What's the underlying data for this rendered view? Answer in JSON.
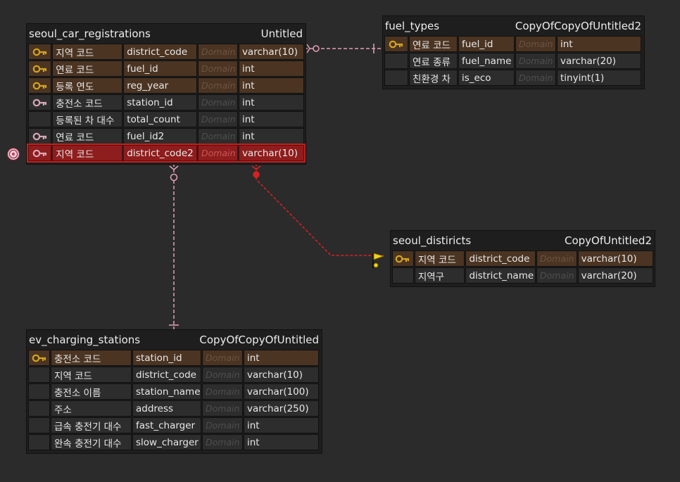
{
  "tables": {
    "seoul_car_registrations": {
      "name": "seoul_car_registrations",
      "model": "Untitled",
      "rows": [
        {
          "label": "지역 코드",
          "column": "district_code",
          "domain": "Domain",
          "type": "varchar(10)",
          "key": "pk"
        },
        {
          "label": "연료 코드",
          "column": "fuel_id",
          "domain": "Domain",
          "type": "int",
          "key": "pk"
        },
        {
          "label": "등록 연도",
          "column": "reg_year",
          "domain": "Domain",
          "type": "int",
          "key": "pk"
        },
        {
          "label": "충전소 코드",
          "column": "station_id",
          "domain": "Domain",
          "type": "int",
          "key": "fk"
        },
        {
          "label": "등록된 차 대수",
          "column": "total_count",
          "domain": "Domain",
          "type": "int",
          "key": "none"
        },
        {
          "label": "연료 코드",
          "column": "fuel_id2",
          "domain": "Domain",
          "type": "int",
          "key": "fk"
        },
        {
          "label": "지역 코드",
          "column": "district_code2",
          "domain": "Domain",
          "type": "varchar(10)",
          "key": "fk"
        }
      ]
    },
    "fuel_types": {
      "name": "fuel_types",
      "model": "CopyOfCopyOfUntitled2",
      "rows": [
        {
          "label": "연료 코드",
          "column": "fuel_id",
          "domain": "Domain",
          "type": "int",
          "key": "pk"
        },
        {
          "label": "연료 종류",
          "column": "fuel_name",
          "domain": "Domain",
          "type": "varchar(20)",
          "key": "none"
        },
        {
          "label": "친환경 차",
          "column": "is_eco",
          "domain": "Domain",
          "type": "tinyint(1)",
          "key": "none"
        }
      ]
    },
    "seoul_distiricts": {
      "name": "seoul_distiricts",
      "model": "CopyOfUntitled2",
      "rows": [
        {
          "label": "지역 코드",
          "column": "district_code",
          "domain": "Domain",
          "type": "varchar(10)",
          "key": "pk"
        },
        {
          "label": "지역구",
          "column": "district_name",
          "domain": "Domain",
          "type": "varchar(20)",
          "key": "none"
        }
      ]
    },
    "ev_charging_stations": {
      "name": "ev_charging_stations",
      "model": "CopyOfCopyOfUntitled",
      "rows": [
        {
          "label": "충전소 코드",
          "column": "station_id",
          "domain": "Domain",
          "type": "int",
          "key": "pk"
        },
        {
          "label": "지역 코드",
          "column": "district_code",
          "domain": "Domain",
          "type": "varchar(10)",
          "key": "none"
        },
        {
          "label": "충전소 이름",
          "column": "station_name",
          "domain": "Domain",
          "type": "varchar(100)",
          "key": "none"
        },
        {
          "label": "주소",
          "column": "address",
          "domain": "Domain",
          "type": "varchar(250)",
          "key": "none"
        },
        {
          "label": "급속 충전기 대수",
          "column": "fast_charger",
          "domain": "Domain",
          "type": "int",
          "key": "none"
        },
        {
          "label": "완속 충전기 대수",
          "column": "slow_charger",
          "domain": "Domain",
          "type": "int",
          "key": "none"
        }
      ]
    }
  },
  "selected_row": {
    "table": "seoul_car_registrations",
    "row": 6
  },
  "colors": {
    "background": "#2b2b2b",
    "table_bg": "#1e1e1e",
    "primary_key_row": "#4b3422",
    "selected_row": "#8e1d1d",
    "pk_key_icon": "#d4a41c",
    "fk_key_icon": "#d9a6b8",
    "relation_line": "#e7a0b4",
    "selected_relation_line": "#d42222"
  },
  "icons": {
    "primary_key": "gold-key-icon",
    "foreign_key": "pink-key-icon",
    "selected_marker": "target-icon",
    "relation_flag": "yellow-flag-icon"
  }
}
